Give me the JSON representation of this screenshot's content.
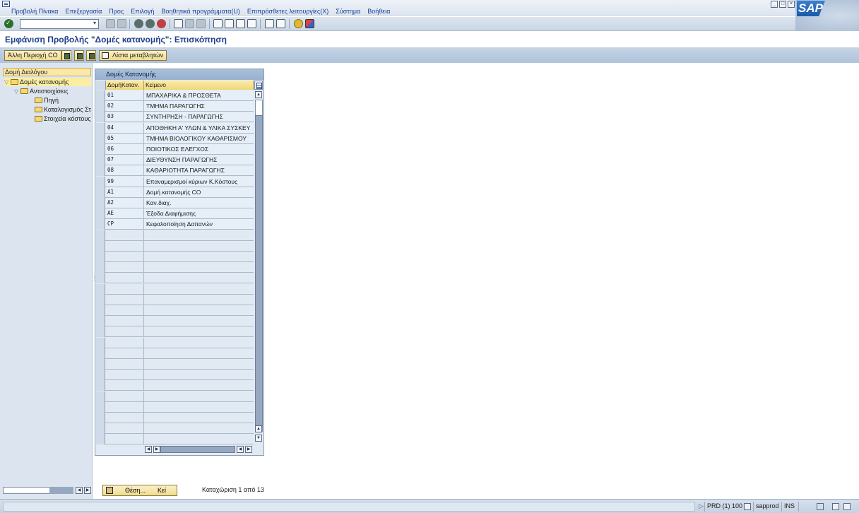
{
  "menu": {
    "items": [
      "Προβολή Πίνακα",
      "Επεξεργασία",
      "Προς",
      "Επιλογή",
      "Βοηθητικά προγράμματα(U)",
      "Επιπρόσθετες λειτουργίες(X)",
      "Σύστημα",
      "Βοήθεια"
    ]
  },
  "page": {
    "title": "Εμφάνιση Προβολής \"Δομές κατανομής\": Επισκόπηση"
  },
  "app_toolbar": {
    "other_area_label": "Άλλη Περιοχή CO",
    "variable_list_label": "Λίστα μεταβλητών"
  },
  "tree": {
    "header": "Δομή Διαλόγου",
    "nodes": [
      "Δομές κατανομής",
      "Αντιστοιχίσεις",
      "Πηγή",
      "Καταλογισμός Στοιχείων",
      "Στοιχεία κόστους"
    ]
  },
  "table": {
    "title": "Δομές Κατανομής",
    "columns": [
      "ΔομήΚαταν.",
      "Κείμενο"
    ],
    "rows": [
      {
        "key": "01",
        "text": "ΜΠΑΧΑΡΙΚΑ & ΠΡΟΣΘΕΤΑ"
      },
      {
        "key": "02",
        "text": "ΤΜΗΜΑ ΠΑΡΑΓΩΓΗΣ"
      },
      {
        "key": "03",
        "text": "ΣΥΝΤΗΡΗΣΗ - ΠΑΡΑΓΩΓΗΣ"
      },
      {
        "key": "04",
        "text": "ΑΠΟΘΗΚΗ Α' ΥΛΩΝ & ΥΛΙΚΑ ΣΥΣΚΕΥ"
      },
      {
        "key": "05",
        "text": "ΤΜΗΜΑ ΒΙΟΛΟΓΙΚΟΥ ΚΑΘΑΡΙΣΜΟΥ"
      },
      {
        "key": "06",
        "text": "ΠΟΙΟΤΙΚΟΣ ΕΛΕΓΧΟΣ"
      },
      {
        "key": "07",
        "text": "ΔΙΕΥΘΥΝΣΗ ΠΑΡΑΓΩΓΗΣ"
      },
      {
        "key": "08",
        "text": "ΚΑΘΑΡΙΟΤΗΤΑ ΠΑΡΑΓΩΓΗΣ"
      },
      {
        "key": "99",
        "text": "Επαναμερισμοί κύριων Κ.Κόστους"
      },
      {
        "key": "A1",
        "text": "Δομή κατανομής CO"
      },
      {
        "key": "A2",
        "text": "Καν.διαχ."
      },
      {
        "key": "AE",
        "text": "Έξοδα Διαφήμισης"
      },
      {
        "key": "CP",
        "text": "Κεφαλοποίηση Δαπανών"
      }
    ]
  },
  "bottom": {
    "position_label": "Θέση...",
    "position_shortcut": "Κεί",
    "entry_count": "Καταχώριση 1 από 13"
  },
  "status": {
    "system": "PRD (1) 100",
    "server": "sapprod",
    "mode": "INS"
  },
  "icons": {
    "enter": "check-icon",
    "back": "back-icon",
    "exit": "exit-icon",
    "cancel": "cancel-icon",
    "print": "print-icon",
    "help": "help-icon",
    "customize": "customize-layout-icon"
  },
  "colors": {
    "title": "#1d3f8a",
    "menu_text": "#1a3f9a",
    "button_face": "#f0dc8e",
    "tree_header": "#fbe8a8",
    "toolbar_bg": "#c9d6e4"
  }
}
